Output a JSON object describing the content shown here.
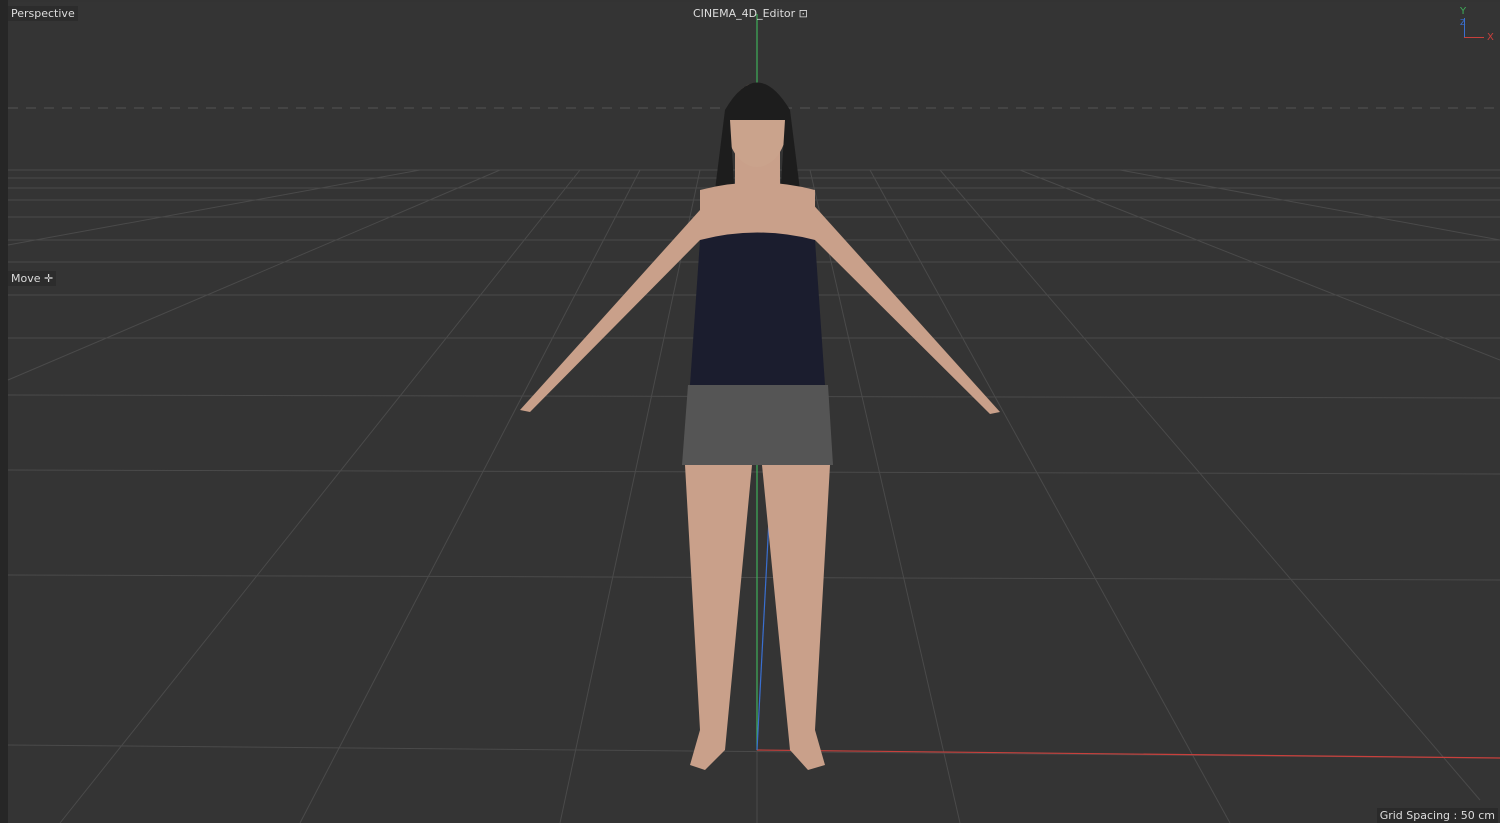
{
  "viewport": {
    "view_name": "Perspective",
    "camera_name": "CINEMA_4D_Editor",
    "tool_name": "Move",
    "grid_spacing": "Grid Spacing : 50 cm"
  },
  "axes": {
    "x_label": "X",
    "y_label": "Y",
    "z_label": "Z"
  },
  "colors": {
    "background": "#343434",
    "x_axis": "#c8403c",
    "y_axis": "#3fae5a",
    "z_axis": "#3a6fd0"
  }
}
